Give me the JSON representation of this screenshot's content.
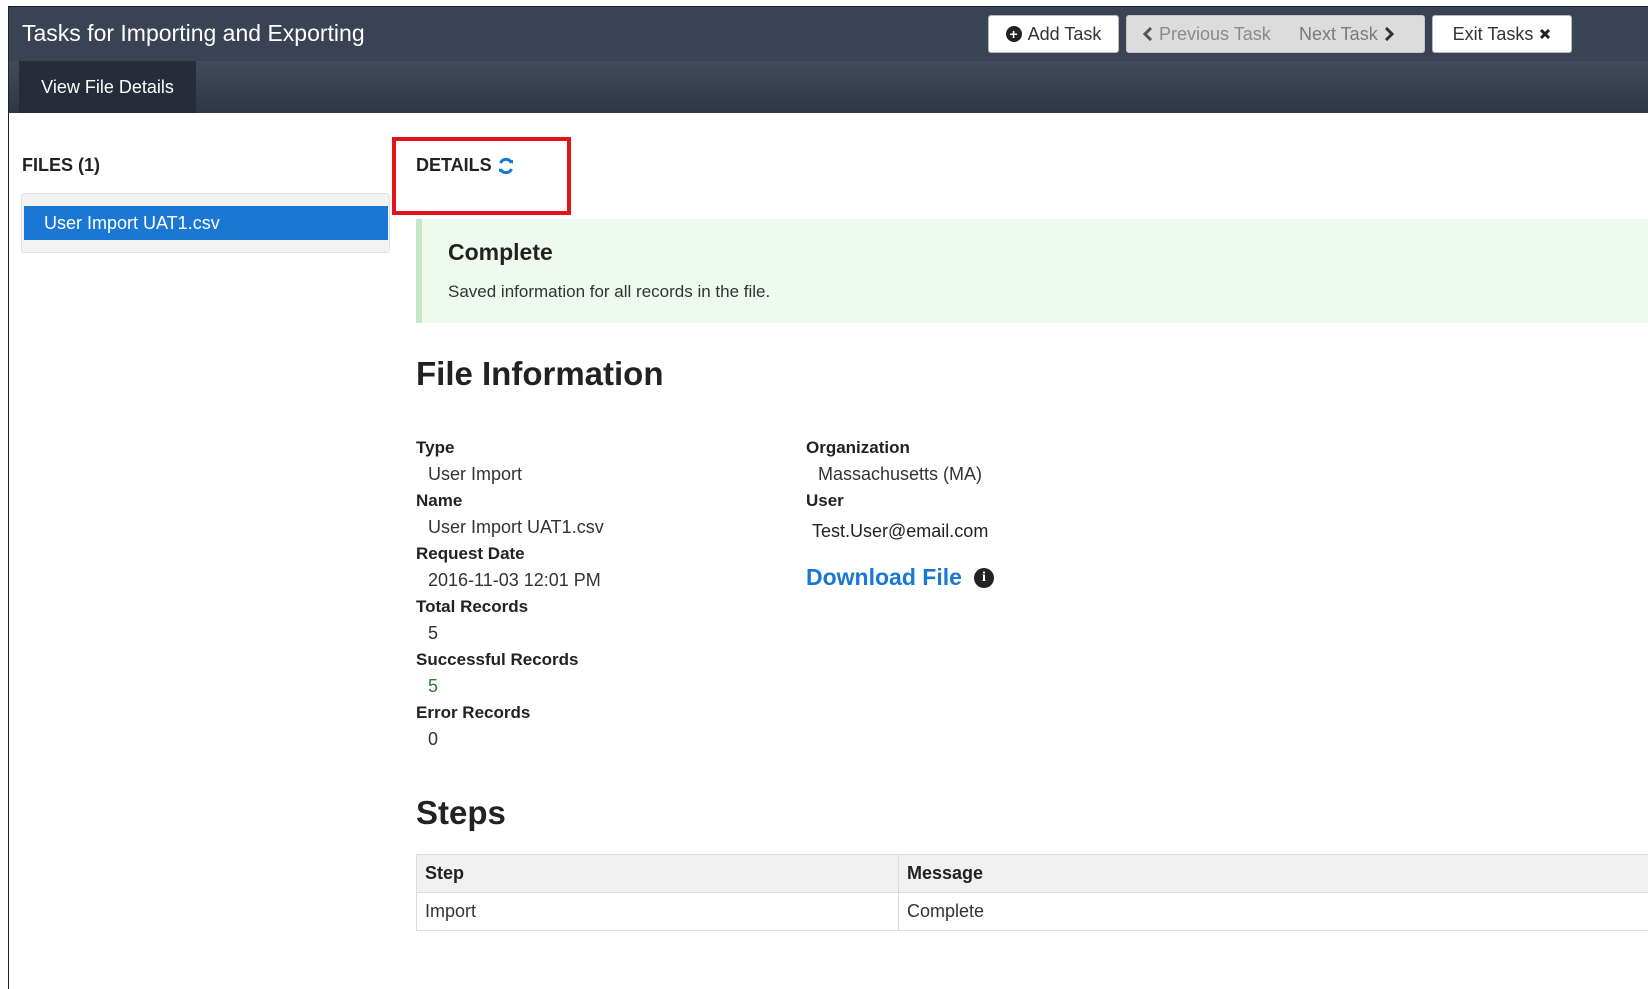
{
  "header": {
    "title": "Tasks for Importing and Exporting",
    "add_task": "Add Task",
    "previous_task": "Previous Task",
    "next_task": "Next Task",
    "exit_tasks": "Exit Tasks"
  },
  "subnav": {
    "active_tab": "View File Details"
  },
  "files": {
    "title": "FILES (1)",
    "items": [
      {
        "label": "User Import UAT1.csv"
      }
    ]
  },
  "details": {
    "title": "DETAILS",
    "status_title": "Complete",
    "status_message": "Saved information for all records in the file."
  },
  "file_info": {
    "heading": "File Information",
    "type_label": "Type",
    "type_value": "User Import",
    "name_label": "Name",
    "name_value": "User Import UAT1.csv",
    "request_date_label": "Request Date",
    "request_date_value": "2016-11-03 12:01 PM",
    "total_records_label": "Total Records",
    "total_records_value": "5",
    "successful_records_label": "Successful Records",
    "successful_records_value": "5",
    "error_records_label": "Error Records",
    "error_records_value": "0",
    "organization_label": "Organization",
    "organization_value": "Massachusetts (MA)",
    "user_label": "User",
    "user_value": "Test.User@email.com",
    "download_label": "Download File"
  },
  "steps": {
    "heading": "Steps",
    "columns": [
      "Step",
      "Message"
    ],
    "rows": [
      [
        "Import",
        "Complete"
      ]
    ]
  },
  "colors": {
    "accent": "#1a78d4",
    "header_bg": "#3a4354",
    "success_bg": "#eefaee",
    "highlight": "#e5141a"
  }
}
